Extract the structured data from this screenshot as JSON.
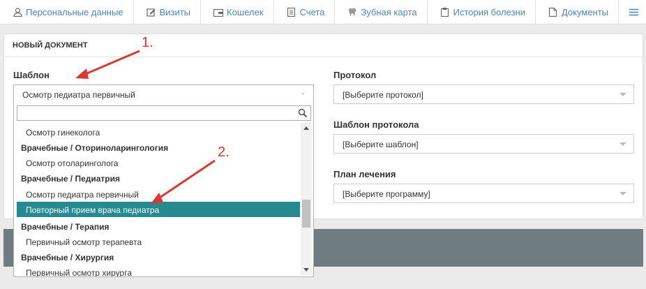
{
  "tabs": [
    {
      "label": "Персональные данные",
      "icon": "user-icon"
    },
    {
      "label": "Визиты",
      "icon": "edit-icon"
    },
    {
      "label": "Кошелек",
      "icon": "wallet-icon"
    },
    {
      "label": "Счета",
      "icon": "document-list-icon"
    },
    {
      "label": "Зубная карта",
      "icon": "tooth-icon"
    },
    {
      "label": "История болезни",
      "icon": "clipboard-icon"
    },
    {
      "label": "Документы",
      "icon": "file-icon"
    }
  ],
  "panel": {
    "title": "НОВЫЙ ДОКУМЕНТ",
    "template_label": "Шаблон",
    "template_value": "Осмотр педиатра первичный",
    "protocol_label": "Протокол",
    "protocol_value": "[Выберите протокол]",
    "protocol_template_label": "Шаблон протокола",
    "protocol_template_value": "[Выберите шаблон]",
    "treatment_plan_label": "План лечения",
    "treatment_plan_value": "[Выберите программу]"
  },
  "dropdown": {
    "search_value": "",
    "items": [
      {
        "type": "option",
        "label": "Осмотр гинеколога"
      },
      {
        "type": "group",
        "label": "Врачебные / Оториноларингология"
      },
      {
        "type": "option",
        "label": "Осмотр отоларинголога"
      },
      {
        "type": "group",
        "label": "Врачебные / Педиатрия"
      },
      {
        "type": "option",
        "label": "Осмотр педиатра первичный"
      },
      {
        "type": "option",
        "label": "Повторный прием врача педиатра",
        "highlighted": true
      },
      {
        "type": "group",
        "label": "Врачебные / Терапия"
      },
      {
        "type": "option",
        "label": "Первичный осмотр терапевта"
      },
      {
        "type": "group",
        "label": "Врачебные / Хирургия"
      },
      {
        "type": "option",
        "label": "Первичный осмотр хирурга"
      }
    ]
  },
  "annotations": {
    "first": "1.",
    "second": "2."
  },
  "colors": {
    "highlight": "#268b91",
    "link": "#4a86b5",
    "annotation": "#d93a2f",
    "footer": "#6f7c80"
  }
}
